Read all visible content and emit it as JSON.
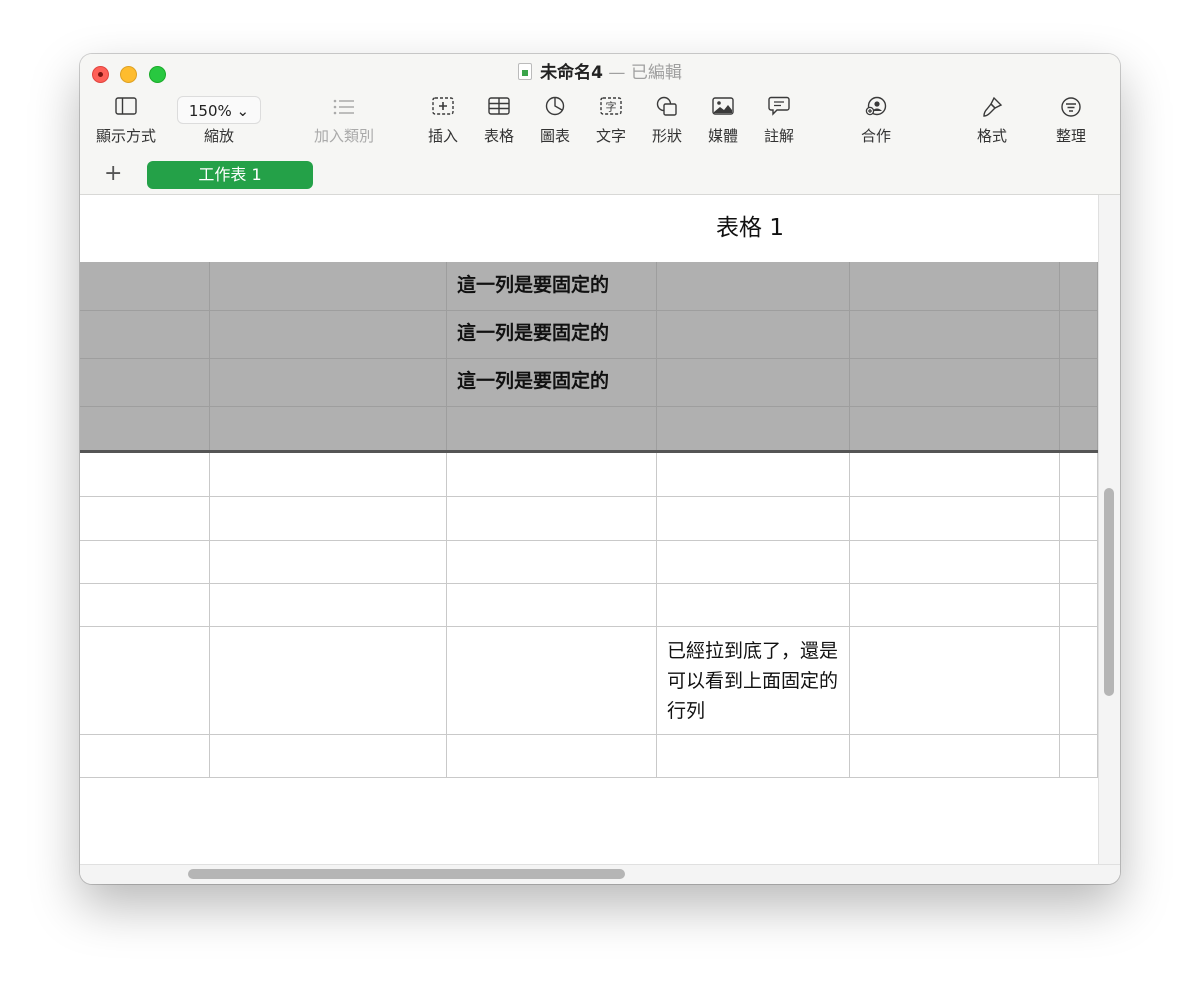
{
  "window": {
    "doc_name": "未命名4",
    "separator": "—",
    "doc_status": "已編輯"
  },
  "toolbar": {
    "view": {
      "icon": "sidebar-icon",
      "label": "顯示方式"
    },
    "zoom": {
      "value": "150% ⌄",
      "label": "縮放"
    },
    "category": {
      "icon": "list-icon",
      "label": "加入類別"
    },
    "insert": {
      "icon": "insert-icon",
      "label": "插入"
    },
    "table": {
      "icon": "table-icon",
      "label": "表格"
    },
    "chart": {
      "icon": "chart-icon",
      "label": "圖表"
    },
    "text": {
      "icon": "text-box-icon",
      "label": "文字"
    },
    "shape": {
      "icon": "shape-icon",
      "label": "形狀"
    },
    "media": {
      "icon": "media-icon",
      "label": "媒體"
    },
    "comment": {
      "icon": "comment-icon",
      "label": "註解"
    },
    "collaborate": {
      "icon": "collaborate-icon",
      "label": "合作"
    },
    "format": {
      "icon": "paintbrush-icon",
      "label": "格式"
    },
    "organize": {
      "icon": "organize-icon",
      "label": "整理"
    }
  },
  "sheets": {
    "add_label": "+",
    "active": "工作表 1"
  },
  "table": {
    "title": "表格 1",
    "header_rows": [
      [
        "",
        "",
        "這一列是要固定的",
        "",
        "",
        ""
      ],
      [
        "",
        "",
        "這一列是要固定的",
        "",
        "",
        ""
      ],
      [
        "",
        "",
        "這一列是要固定的",
        "",
        "",
        ""
      ],
      [
        "",
        "",
        "",
        "",
        "",
        ""
      ]
    ],
    "body_rows": [
      [
        "",
        "",
        "",
        "",
        "",
        ""
      ],
      [
        "",
        "",
        "",
        "",
        "",
        ""
      ],
      [
        "",
        "",
        "",
        "",
        "",
        ""
      ],
      [
        "",
        "",
        "",
        "",
        "",
        ""
      ],
      [
        "",
        "",
        "",
        "已經拉到底了，還是可以看到上面固定的行列",
        "",
        ""
      ],
      [
        "",
        "",
        "",
        "",
        "",
        ""
      ]
    ]
  }
}
